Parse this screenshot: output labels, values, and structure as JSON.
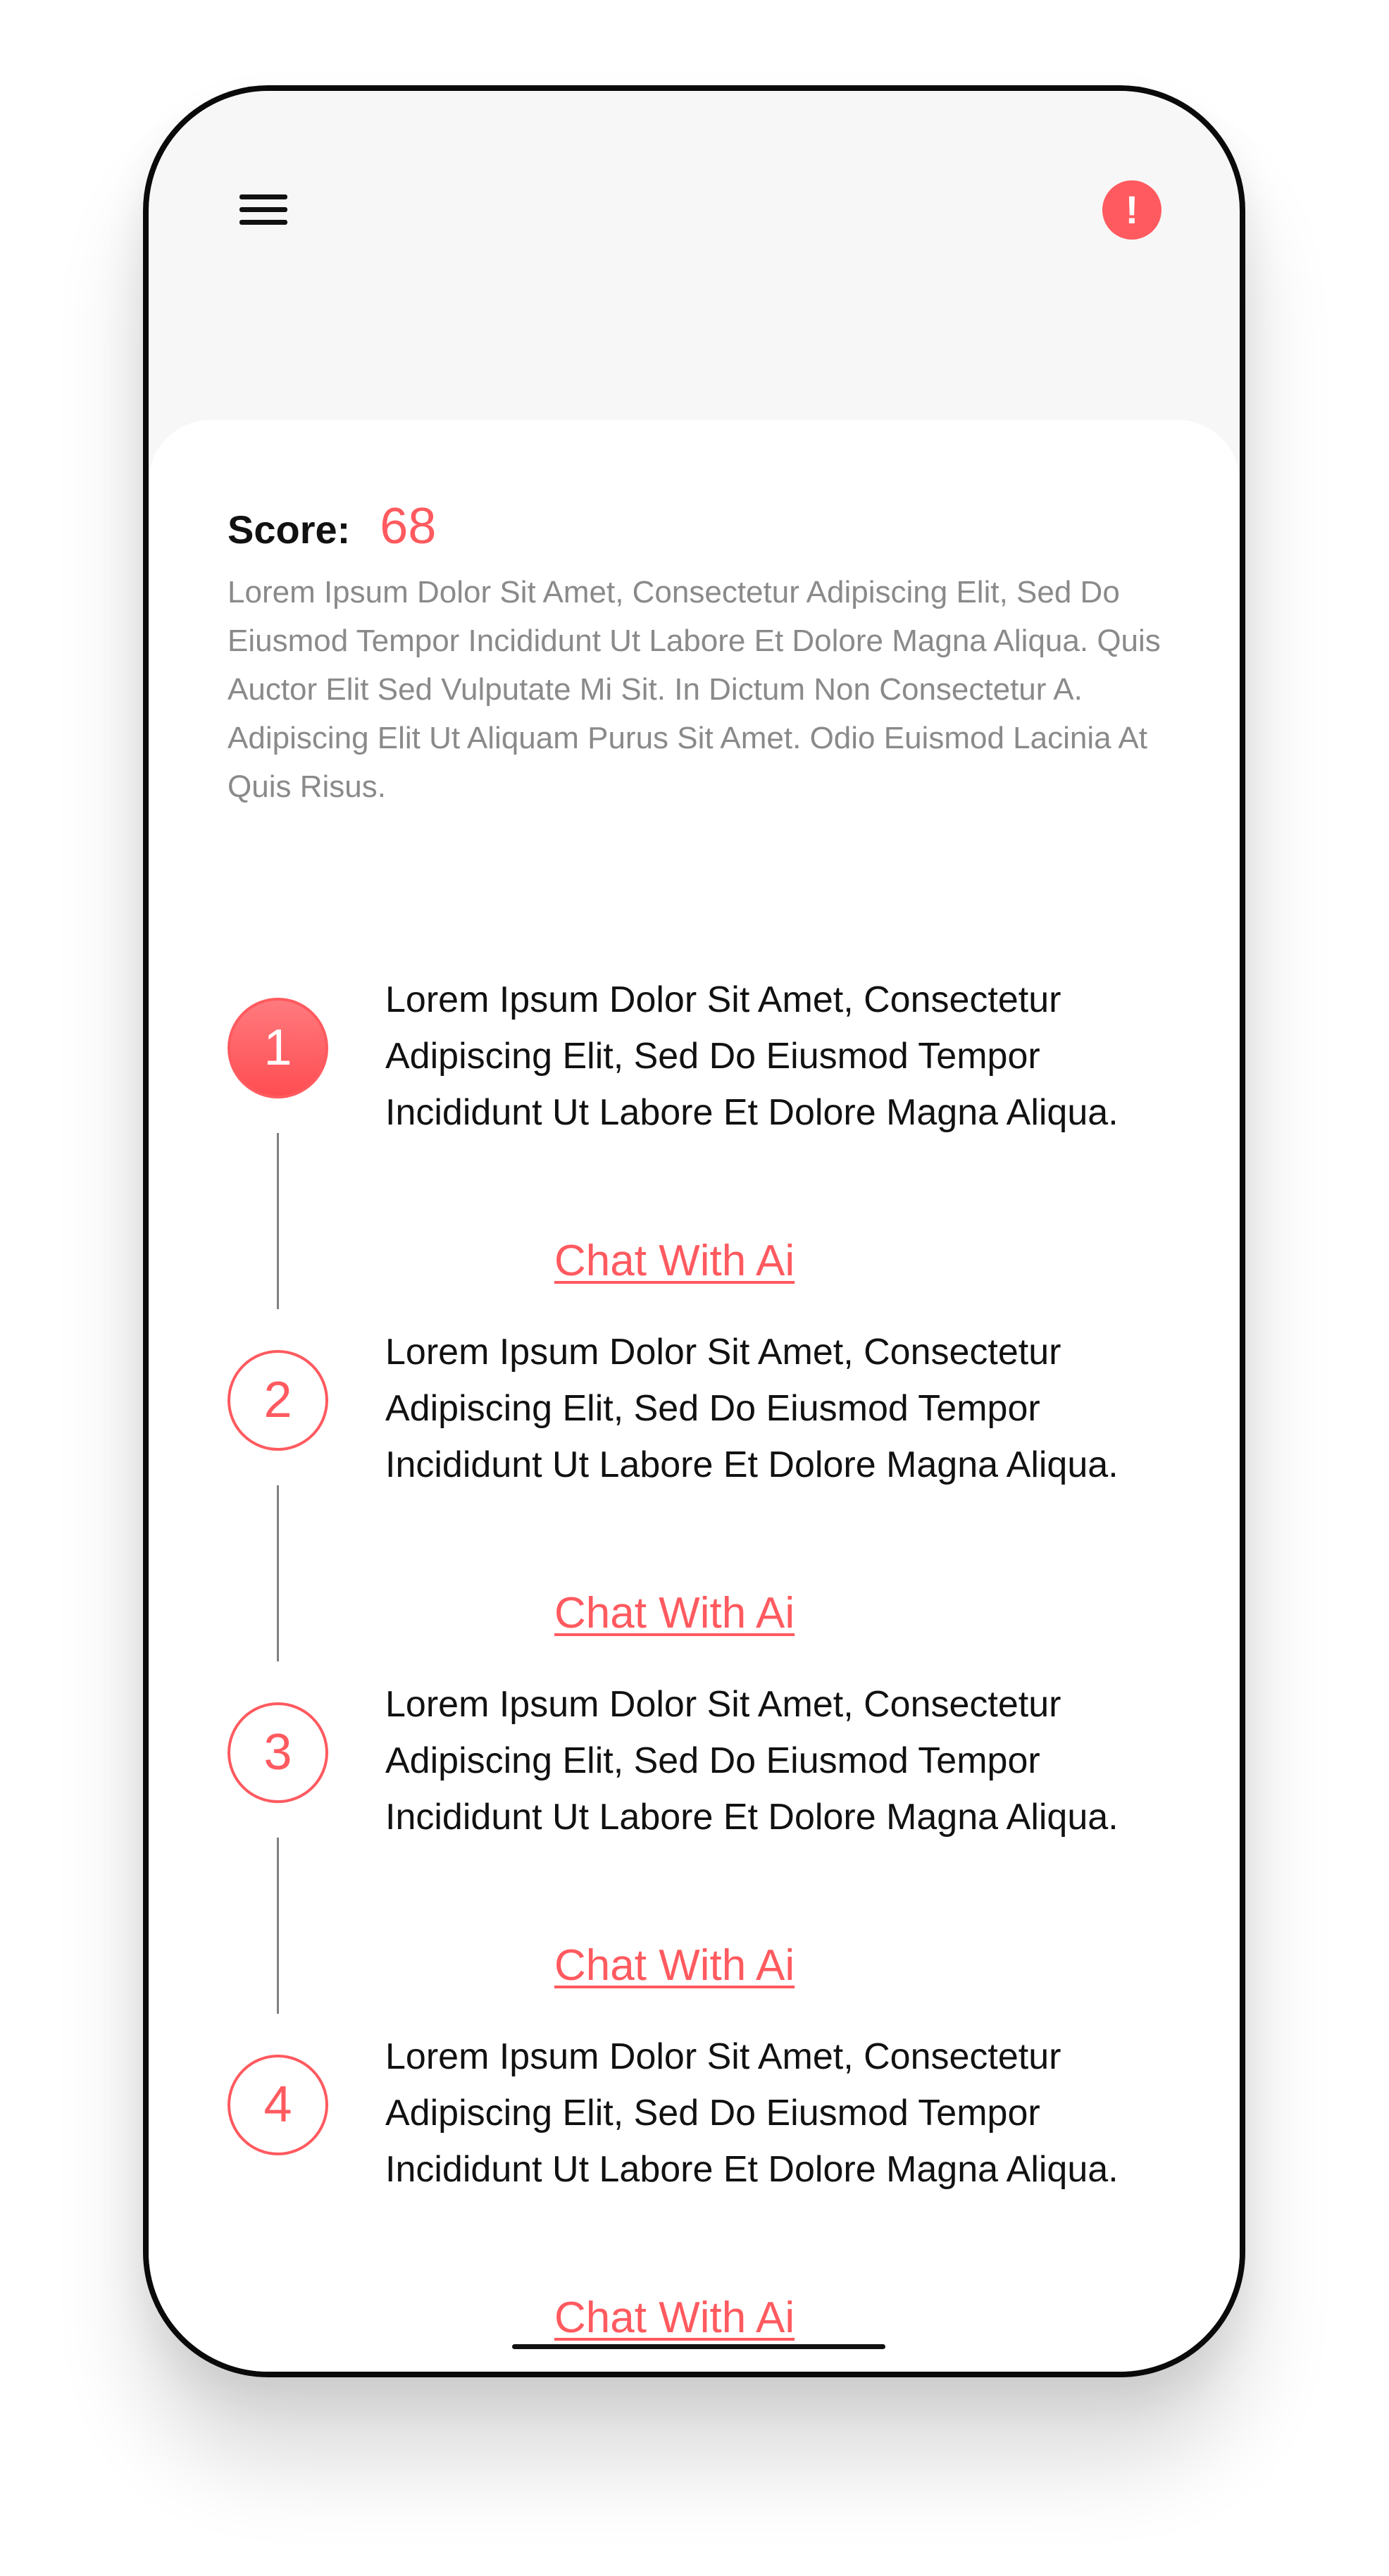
{
  "header": {
    "menu_icon": "hamburger-menu-icon",
    "alert_icon": "exclamation-alert-icon",
    "alert_symbol": "!"
  },
  "score": {
    "label": "Score:",
    "value": "68"
  },
  "description": "Lorem Ipsum Dolor Sit Amet, Consectetur Adipiscing Elit, Sed Do Eiusmod Tempor Incididunt Ut Labore Et Dolore Magna Aliqua. Quis Auctor Elit Sed Vulputate Mi Sit. In Dictum Non Consectetur A. Adipiscing Elit Ut Aliquam Purus Sit Amet. Odio Euismod Lacinia At Quis Risus.",
  "steps": [
    {
      "number": "1",
      "text": "Lorem Ipsum Dolor Sit Amet, Consectetur Adipiscing Elit, Sed Do Eiusmod Tempor Incididunt Ut Labore Et Dolore Magna Aliqua.",
      "link": "Chat With Ai"
    },
    {
      "number": "2",
      "text": "Lorem Ipsum Dolor Sit Amet, Consectetur Adipiscing Elit, Sed Do Eiusmod Tempor Incididunt Ut Labore Et Dolore Magna Aliqua.",
      "link": "Chat With Ai"
    },
    {
      "number": "3",
      "text": "Lorem Ipsum Dolor Sit Amet, Consectetur Adipiscing Elit, Sed Do Eiusmod Tempor Incididunt Ut Labore Et Dolore Magna Aliqua.",
      "link": "Chat With Ai"
    },
    {
      "number": "4",
      "text": "Lorem Ipsum Dolor Sit Amet, Consectetur Adipiscing Elit, Sed Do Eiusmod Tempor Incididunt Ut Labore Et Dolore Magna Aliqua.",
      "link": "Chat With Ai"
    }
  ],
  "colors": {
    "accent": "#ff5a5f",
    "text": "#111111",
    "muted_text": "#8a8a8a",
    "background": "#f7f7f7"
  }
}
